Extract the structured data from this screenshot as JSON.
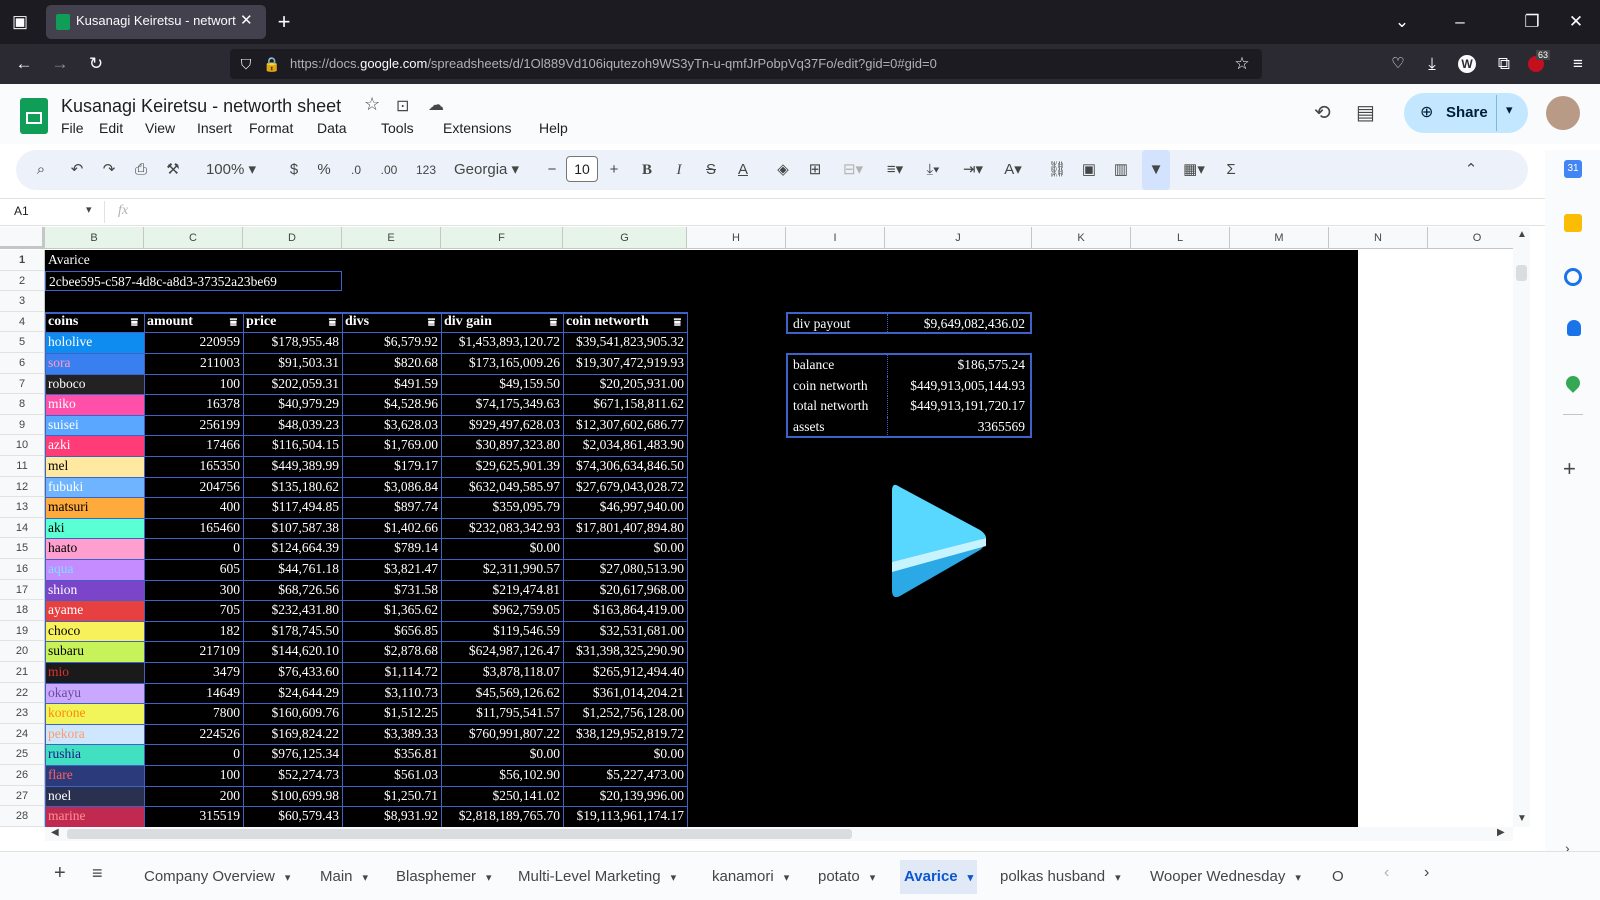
{
  "browser": {
    "tab_title": "Kusanagi Keiretsu - networth sh",
    "url_prefix": "https://docs.",
    "url_domain": "google.com",
    "url_path": "/spreadsheets/d/1Ol889Vd106iqutezoh9WS3yTn-u-qmfJrPobpVq37Fo/edit?gid=0#gid=0",
    "badge": "63"
  },
  "doc": {
    "title": "Kusanagi Keiretsu - networth sheet",
    "menu": [
      "File",
      "Edit",
      "View",
      "Insert",
      "Format",
      "Data",
      "Tools",
      "Extensions",
      "Help"
    ],
    "share_label": "Share"
  },
  "toolbar": {
    "zoom": "100%",
    "currency": "$",
    "percent": "%",
    "dec_minus": ".0",
    "dec_plus": ".00",
    "numfmt": "123",
    "font": "Georgia",
    "font_size": "10"
  },
  "formula_bar": {
    "cell_ref": "A1",
    "fx": "fx"
  },
  "columns": [
    "B",
    "C",
    "D",
    "E",
    "F",
    "G",
    "H",
    "I",
    "J",
    "K",
    "L",
    "M",
    "N",
    "O"
  ],
  "rows": [
    "1",
    "2",
    "3",
    "4",
    "5",
    "6",
    "7",
    "8",
    "9",
    "10",
    "11",
    "12",
    "13",
    "14",
    "15",
    "16",
    "17",
    "18",
    "19",
    "20",
    "21",
    "22",
    "23",
    "24",
    "25",
    "26",
    "27",
    "28"
  ],
  "sheet": {
    "title_cell": "Avarice",
    "uuid": "2cbee595-c587-4d8c-a8d3-37352a23be69",
    "headers": [
      "coins",
      "amount",
      "price",
      "divs",
      "div gain",
      "coin networth"
    ],
    "data": [
      [
        "hololive",
        "220959",
        "$178,955.48",
        "$6,579.92",
        "$1,453,893,120.72",
        "$39,541,823,905.32"
      ],
      [
        "sora",
        "211003",
        "$91,503.31",
        "$820.68",
        "$173,165,009.26",
        "$19,307,472,919.93"
      ],
      [
        "roboco",
        "100",
        "$202,059.31",
        "$491.59",
        "$49,159.50",
        "$20,205,931.00"
      ],
      [
        "miko",
        "16378",
        "$40,979.29",
        "$4,528.96",
        "$74,175,349.63",
        "$671,158,811.62"
      ],
      [
        "suisei",
        "256199",
        "$48,039.23",
        "$3,628.03",
        "$929,497,628.03",
        "$12,307,602,686.77"
      ],
      [
        "azki",
        "17466",
        "$116,504.15",
        "$1,769.00",
        "$30,897,323.80",
        "$2,034,861,483.90"
      ],
      [
        "mel",
        "165350",
        "$449,389.99",
        "$179.17",
        "$29,625,901.39",
        "$74,306,634,846.50"
      ],
      [
        "fubuki",
        "204756",
        "$135,180.62",
        "$3,086.84",
        "$632,049,585.97",
        "$27,679,043,028.72"
      ],
      [
        "matsuri",
        "400",
        "$117,494.85",
        "$897.74",
        "$359,095.79",
        "$46,997,940.00"
      ],
      [
        "aki",
        "165460",
        "$107,587.38",
        "$1,402.66",
        "$232,083,342.93",
        "$17,801,407,894.80"
      ],
      [
        "haato",
        "0",
        "$124,664.39",
        "$789.14",
        "$0.00",
        "$0.00"
      ],
      [
        "aqua",
        "605",
        "$44,761.18",
        "$3,821.47",
        "$2,311,990.57",
        "$27,080,513.90"
      ],
      [
        "shion",
        "300",
        "$68,726.56",
        "$731.58",
        "$219,474.81",
        "$20,617,968.00"
      ],
      [
        "ayame",
        "705",
        "$232,431.80",
        "$1,365.62",
        "$962,759.05",
        "$163,864,419.00"
      ],
      [
        "choco",
        "182",
        "$178,745.50",
        "$656.85",
        "$119,546.59",
        "$32,531,681.00"
      ],
      [
        "subaru",
        "217109",
        "$144,620.10",
        "$2,878.68",
        "$624,987,126.47",
        "$31,398,325,290.90"
      ],
      [
        "mio",
        "3479",
        "$76,433.60",
        "$1,114.72",
        "$3,878,118.07",
        "$265,912,494.40"
      ],
      [
        "okayu",
        "14649",
        "$24,644.29",
        "$3,110.73",
        "$45,569,126.62",
        "$361,014,204.21"
      ],
      [
        "korone",
        "7800",
        "$160,609.76",
        "$1,512.25",
        "$11,795,541.57",
        "$1,252,756,128.00"
      ],
      [
        "pekora",
        "224526",
        "$169,824.22",
        "$3,389.33",
        "$760,991,807.22",
        "$38,129,952,819.72"
      ],
      [
        "rushia",
        "0",
        "$976,125.34",
        "$356.81",
        "$0.00",
        "$0.00"
      ],
      [
        "flare",
        "100",
        "$52,274.73",
        "$561.03",
        "$56,102.90",
        "$5,227,473.00"
      ],
      [
        "noel",
        "200",
        "$100,699.98",
        "$1,250.71",
        "$250,141.02",
        "$20,139,996.00"
      ],
      [
        "marine",
        "315519",
        "$60,579.43",
        "$8,931.92",
        "$2,818,189,765.70",
        "$19,113,961,174.17"
      ]
    ],
    "coin_colors": [
      {
        "bg": "#0f8cf0",
        "fg": "#ffffff"
      },
      {
        "bg": "#3a7ff0",
        "fg": "#ff9ec7"
      },
      {
        "bg": "#222222",
        "fg": "#ffffff"
      },
      {
        "bg": "#ff4fa8",
        "fg": "#ffffff"
      },
      {
        "bg": "#5aa7ff",
        "fg": "#ffffff"
      },
      {
        "bg": "#ff3c78",
        "fg": "#ffffff"
      },
      {
        "bg": "#ffe8a0",
        "fg": "#000000"
      },
      {
        "bg": "#6fb4ff",
        "fg": "#ffffff"
      },
      {
        "bg": "#ffaa3c",
        "fg": "#000000"
      },
      {
        "bg": "#5affd4",
        "fg": "#000000"
      },
      {
        "bg": "#ff9fd0",
        "fg": "#000000"
      },
      {
        "bg": "#c58cff",
        "fg": "#7fdfff"
      },
      {
        "bg": "#7a45c8",
        "fg": "#ffffff"
      },
      {
        "bg": "#e74040",
        "fg": "#ffffff"
      },
      {
        "bg": "#f7f25c",
        "fg": "#000000"
      },
      {
        "bg": "#c8f25a",
        "fg": "#000000"
      },
      {
        "bg": "#1a1a1a",
        "fg": "#e03030"
      },
      {
        "bg": "#caa8ff",
        "fg": "#6a4a9a"
      },
      {
        "bg": "#f2f55a",
        "fg": "#ff8a00"
      },
      {
        "bg": "#cfe6ff",
        "fg": "#ff9a6a"
      },
      {
        "bg": "#40e0c0",
        "fg": "#1a1a8a"
      },
      {
        "bg": "#2b3a7a",
        "fg": "#ff6060"
      },
      {
        "bg": "#2a3050",
        "fg": "#ffffff"
      },
      {
        "bg": "#c02a50",
        "fg": "#ff9090"
      }
    ],
    "payout": {
      "label": "div payout",
      "value": "$9,649,082,436.02"
    },
    "summary": [
      {
        "label": "balance",
        "value": "$186,575.24"
      },
      {
        "label": "coin networth",
        "value": "$449,913,005,144.93"
      },
      {
        "label": "total networth",
        "value": "$449,913,191,720.17"
      },
      {
        "label": "assets",
        "value": "3365569"
      }
    ]
  },
  "sheet_tabs": {
    "items": [
      "Company Overview",
      "Main",
      "Blasphemer",
      "Multi-Level Marketing",
      "kanamori",
      "potato",
      "Avarice",
      "polkas husband",
      "Wooper Wednesday",
      "O"
    ],
    "active": "Avarice"
  }
}
